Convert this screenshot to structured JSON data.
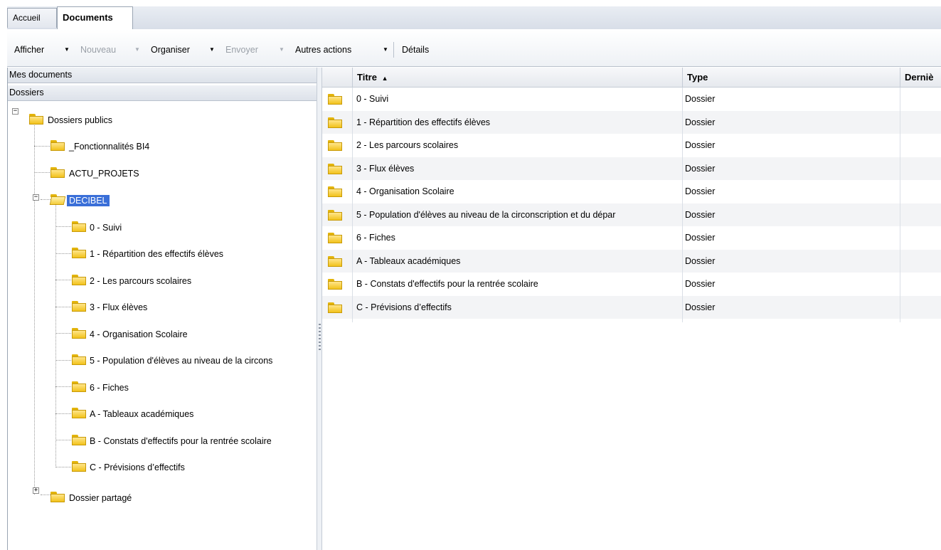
{
  "tabs": {
    "home": "Accueil",
    "documents": "Documents"
  },
  "toolbar": {
    "afficher": "Afficher",
    "nouveau": "Nouveau",
    "organiser": "Organiser",
    "envoyer": "Envoyer",
    "autres_actions": "Autres actions",
    "details": "Détails",
    "dropdown_glyph": "▼"
  },
  "left_pane": {
    "mes_documents": "Mes documents",
    "dossiers": "Dossiers",
    "tree": {
      "public_root": "Dossiers publics",
      "fonctionnalites": "_Fonctionnalités BI4",
      "actu_projets": "ACTU_PROJETS",
      "decibel": "DECIBEL",
      "decibel_children": [
        "0 - Suivi",
        "1 - Répartition des effectifs élèves",
        "2 - Les parcours scolaires",
        "3 - Flux élèves",
        "4 - Organisation Scolaire",
        "5 - Population d'élèves au niveau de la circons",
        "6 - Fiches",
        "A - Tableaux académiques",
        "B - Constats d'effectifs pour la rentrée scolaire",
        "C - Prévisions d’effectifs"
      ],
      "shared": "Dossier partagé",
      "expanded_glyph": "−",
      "collapsed_glyph": "+"
    }
  },
  "list": {
    "columns": {
      "title": "Titre",
      "sort_glyph": "▲",
      "type": "Type",
      "last": "Derniè"
    },
    "rows": [
      {
        "title": "0 - Suivi",
        "type": "Dossier"
      },
      {
        "title": "1 - Répartition des effectifs élèves",
        "type": "Dossier"
      },
      {
        "title": "2 - Les parcours scolaires",
        "type": "Dossier"
      },
      {
        "title": "3 - Flux élèves",
        "type": "Dossier"
      },
      {
        "title": "4 - Organisation Scolaire",
        "type": "Dossier"
      },
      {
        "title": "5 - Population d'élèves au niveau de la circonscription et du dépar",
        "type": "Dossier"
      },
      {
        "title": "6 - Fiches",
        "type": "Dossier"
      },
      {
        "title": "A - Tableaux académiques",
        "type": "Dossier"
      },
      {
        "title": "B - Constats d'effectifs pour la rentrée scolaire",
        "type": "Dossier"
      },
      {
        "title": "C - Prévisions d’effectifs",
        "type": "Dossier"
      }
    ]
  }
}
